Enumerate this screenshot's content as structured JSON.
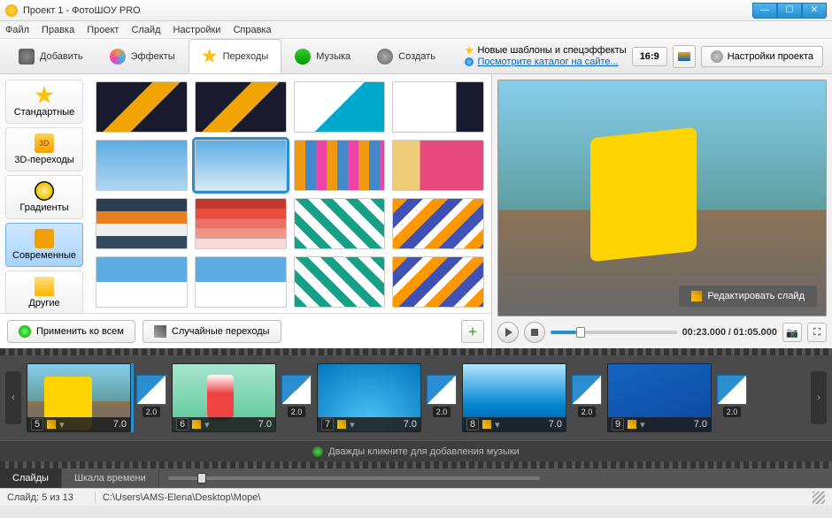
{
  "window": {
    "title": "Проект 1 - ФотоШОУ PRO"
  },
  "menu": [
    "Файл",
    "Правка",
    "Проект",
    "Слайд",
    "Настройки",
    "Справка"
  ],
  "tabs": {
    "add": "Добавить",
    "effects": "Эффекты",
    "transitions": "Переходы",
    "music": "Музыка",
    "create": "Создать",
    "active": "transitions"
  },
  "promo": {
    "line1": "Новые шаблоны и спецэффекты",
    "line2": "Посмотрите каталог на сайте..."
  },
  "aspect_ratio": "16:9",
  "project_settings": "Настройки проекта",
  "categories": [
    {
      "key": "standard",
      "label": "Стандартные"
    },
    {
      "key": "3d",
      "label": "3D-переходы"
    },
    {
      "key": "gradients",
      "label": "Градиенты"
    },
    {
      "key": "modern",
      "label": "Современные"
    },
    {
      "key": "other",
      "label": "Другие"
    }
  ],
  "selected_category": "modern",
  "selected_transition_index": 5,
  "apply_all": "Применить ко всем",
  "random_trans": "Случайные переходы",
  "edit_slide": "Редактировать слайд",
  "playback": {
    "current": "00:23.000",
    "total": "01:05.000"
  },
  "timeline": {
    "slides": [
      {
        "num": 5,
        "dur": "7.0",
        "trans_dur": "2.0",
        "thumb": "s-beach",
        "selected": true
      },
      {
        "num": 6,
        "dur": "7.0",
        "trans_dur": "2.0",
        "thumb": "s-drink"
      },
      {
        "num": 7,
        "dur": "7.0",
        "trans_dur": "2.0",
        "thumb": "s-kids"
      },
      {
        "num": 8,
        "dur": "7.0",
        "trans_dur": "2.0",
        "thumb": "s-board"
      },
      {
        "num": 9,
        "dur": "7.0",
        "trans_dur": "2.0",
        "thumb": "s-star"
      }
    ],
    "music_hint": "Дважды кликните для добавления музыки"
  },
  "view_tabs": {
    "slides": "Слайды",
    "timeline": "Шкала времени",
    "active": "slides"
  },
  "status": {
    "slide_pos": "Слайд: 5 из 13",
    "path": "C:\\Users\\AMS-Elena\\Desktop\\Море\\"
  }
}
